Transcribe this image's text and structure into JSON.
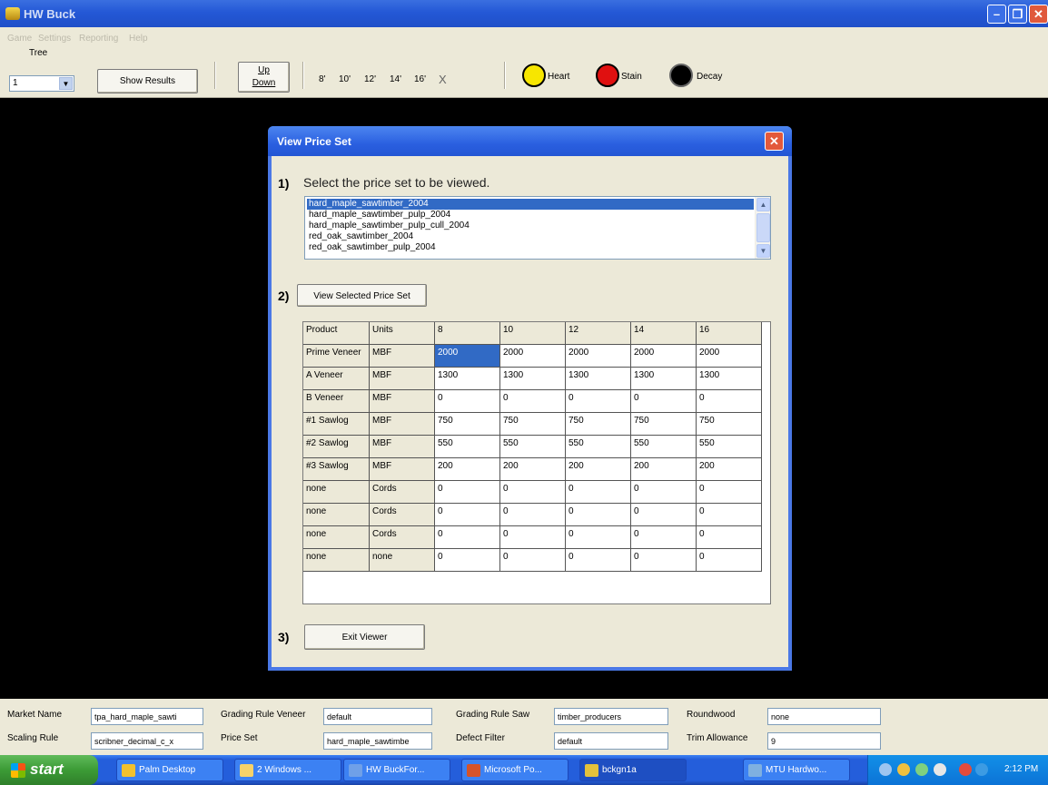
{
  "window": {
    "title": "HW Buck"
  },
  "menu": [
    "Game",
    "Settings",
    "Reporting",
    "Help"
  ],
  "toolbar": {
    "tree_label": "Tree",
    "tree_value": "1",
    "show_results": "Show Results",
    "up": "Up",
    "down": "Down",
    "lengths": [
      "8'",
      "10'",
      "12'",
      "14'",
      "16'"
    ],
    "clear": "X",
    "defects": [
      {
        "label": "Heart",
        "color": "#f7e600"
      },
      {
        "label": "Stain",
        "color": "#e01010"
      },
      {
        "label": "Decay",
        "color": "#000000"
      }
    ]
  },
  "dialog": {
    "title": "View Price Set",
    "step1_num": "1)",
    "step1_text": "Select the price set to be viewed.",
    "price_sets": [
      "hard_maple_sawtimber_2004",
      "hard_maple_sawtimber_pulp_2004",
      "hard_maple_sawtimber_pulp_cull_2004",
      "red_oak_sawtimber_2004",
      "red_oak_sawtimber_pulp_2004"
    ],
    "selected_index": 0,
    "step2_num": "2)",
    "view_button": "View Selected Price Set",
    "columns": [
      "Product",
      "Units",
      "8",
      "10",
      "12",
      "14",
      "16"
    ],
    "rows": [
      [
        "Prime Veneer",
        "MBF",
        "2000",
        "2000",
        "2000",
        "2000",
        "2000"
      ],
      [
        "A Veneer",
        "MBF",
        "1300",
        "1300",
        "1300",
        "1300",
        "1300"
      ],
      [
        "B Veneer",
        "MBF",
        "0",
        "0",
        "0",
        "0",
        "0"
      ],
      [
        "#1 Sawlog",
        "MBF",
        "750",
        "750",
        "750",
        "750",
        "750"
      ],
      [
        "#2 Sawlog",
        "MBF",
        "550",
        "550",
        "550",
        "550",
        "550"
      ],
      [
        "#3 Sawlog",
        "MBF",
        "200",
        "200",
        "200",
        "200",
        "200"
      ],
      [
        "none",
        "Cords",
        "0",
        "0",
        "0",
        "0",
        "0"
      ],
      [
        "none",
        "Cords",
        "0",
        "0",
        "0",
        "0",
        "0"
      ],
      [
        "none",
        "Cords",
        "0",
        "0",
        "0",
        "0",
        "0"
      ],
      [
        "none",
        "none",
        "0",
        "0",
        "0",
        "0",
        "0"
      ]
    ],
    "step3_num": "3)",
    "exit_button": "Exit Viewer"
  },
  "bottom": {
    "market_name_label": "Market Name",
    "market_name": "tpa_hard_maple_sawti",
    "scaling_rule_label": "Scaling Rule",
    "scaling_rule": "scribner_decimal_c_x",
    "grading_veneer_label": "Grading Rule Veneer",
    "grading_veneer": "default",
    "price_set_label": "Price Set",
    "price_set": "hard_maple_sawtimbe",
    "grading_saw_label": "Grading Rule Saw",
    "grading_saw": "timber_producers",
    "defect_filter_label": "Defect Filter",
    "defect_filter": "default",
    "roundwood_label": "Roundwood",
    "roundwood": "none",
    "trim_label": "Trim Allowance",
    "trim": "9"
  },
  "taskbar": {
    "start": "start",
    "tasks": [
      "Palm Desktop",
      "2 Windows ...",
      "HW BuckFor...",
      "Microsoft Po...",
      "bckgn1a",
      "MTU Hardwo..."
    ],
    "clock": "2:12 PM"
  }
}
